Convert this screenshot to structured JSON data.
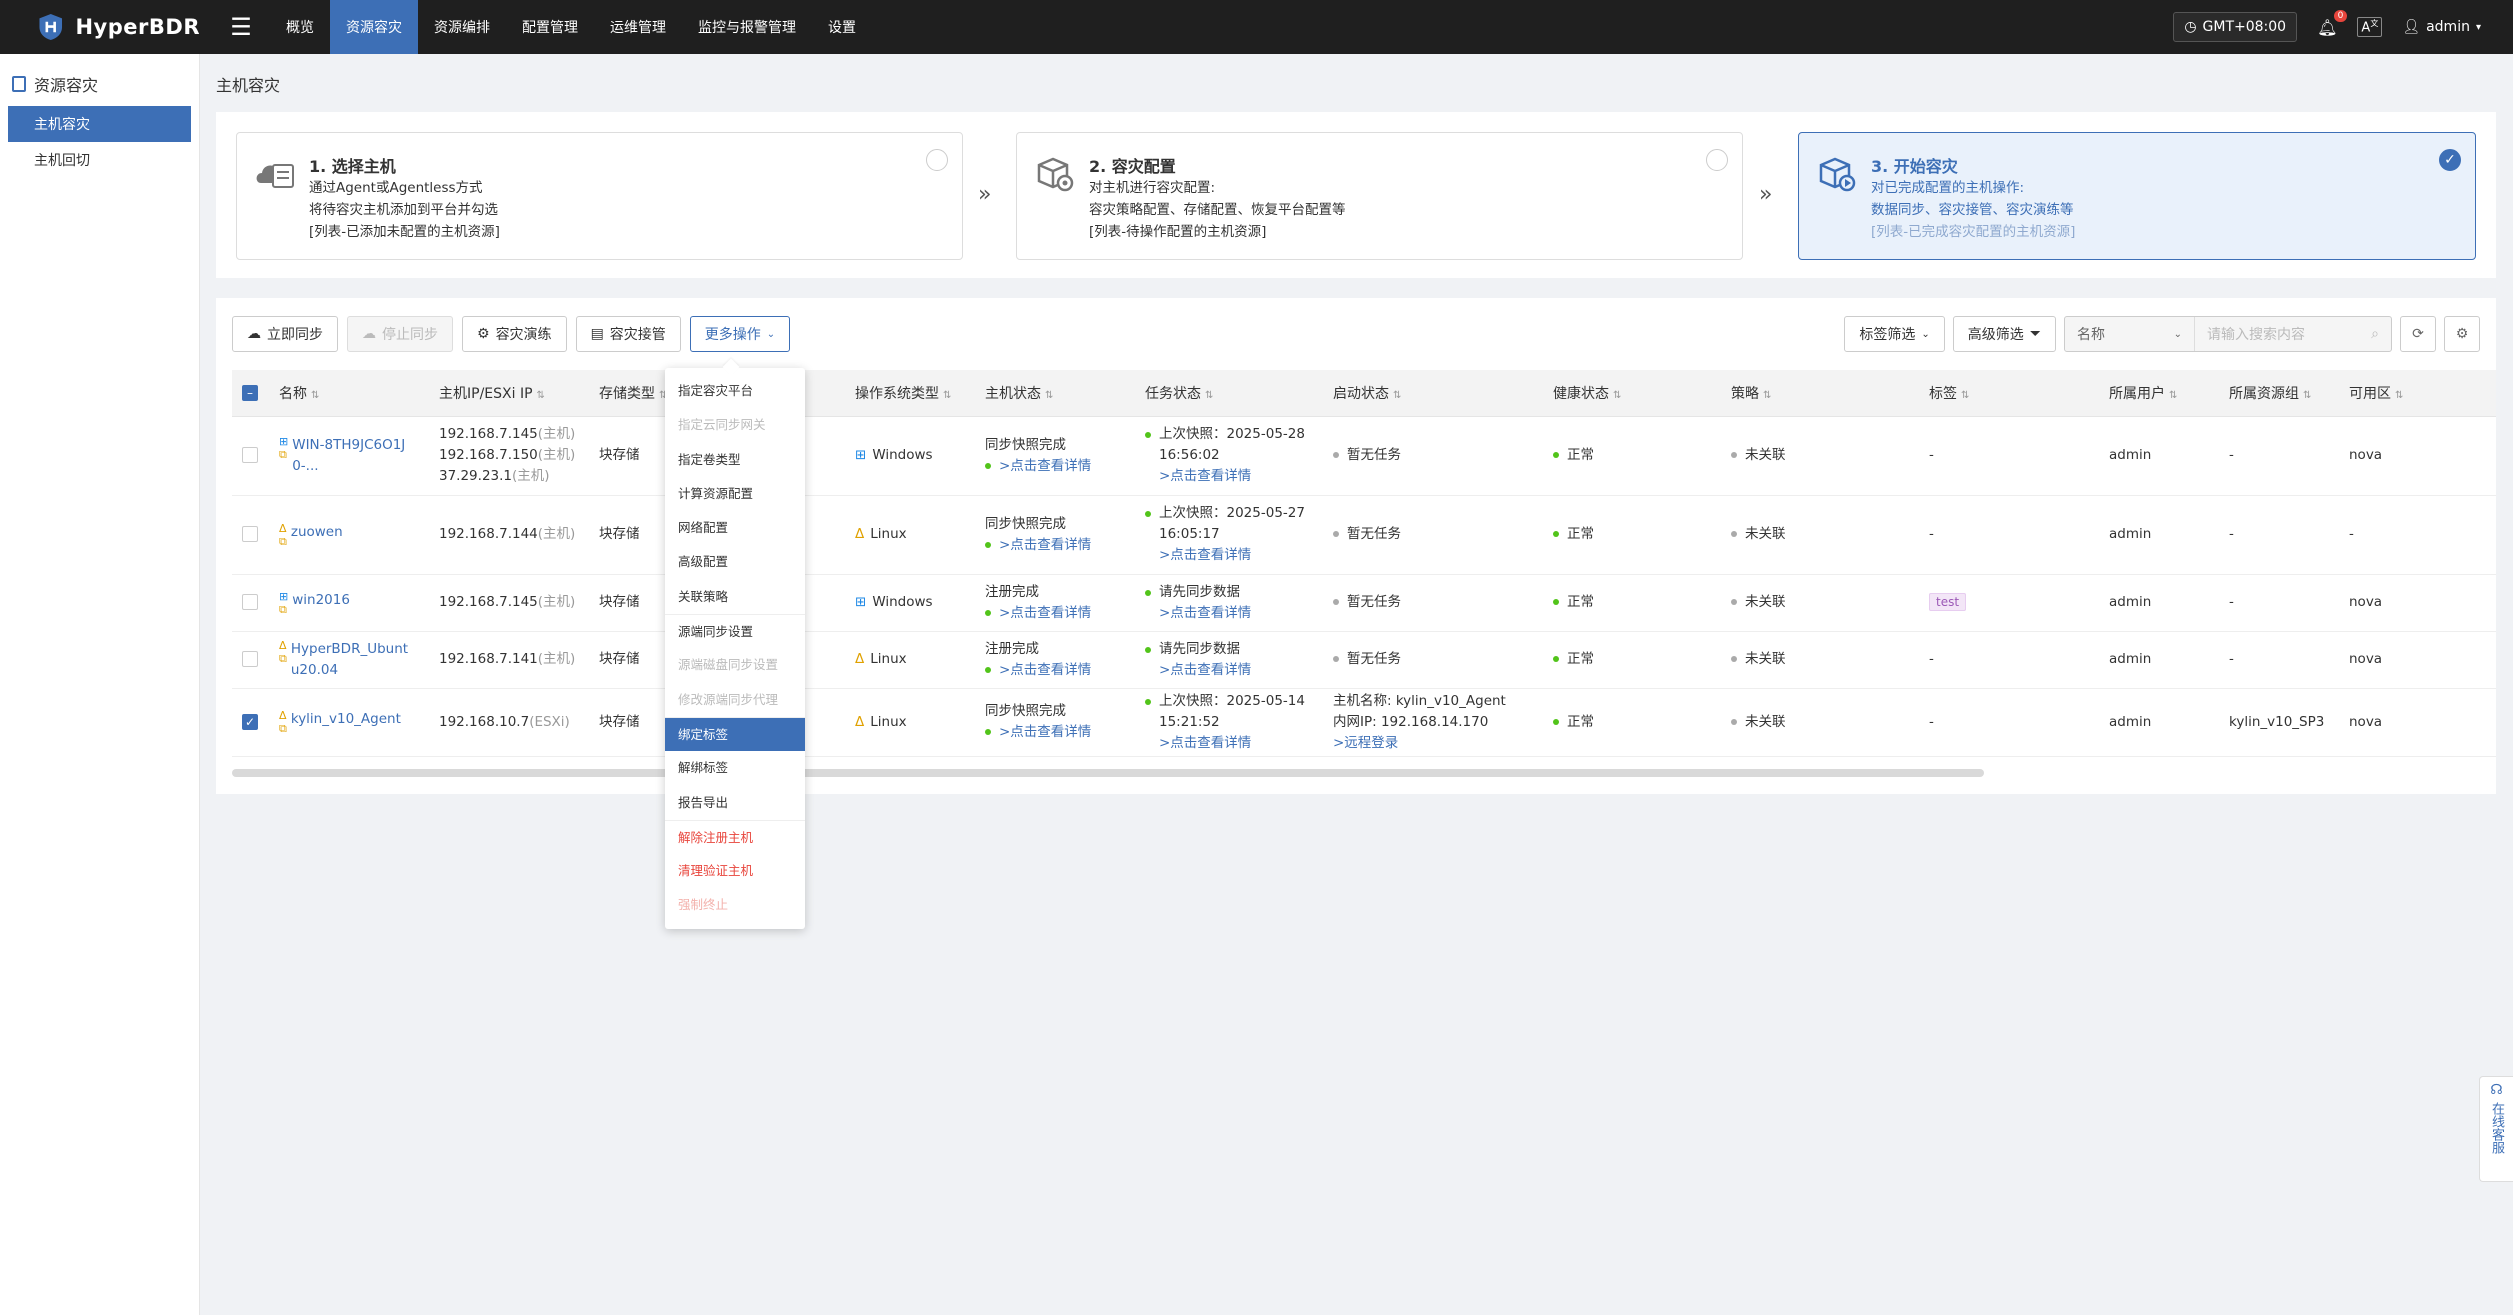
{
  "header": {
    "brand": "HyperBDR",
    "nav": [
      "概览",
      "资源容灾",
      "资源编排",
      "配置管理",
      "运维管理",
      "监控与报警管理",
      "设置"
    ],
    "active_nav": 1,
    "timezone": "GMT+08:00",
    "notification_count": "0",
    "user": "admin"
  },
  "sidebar": {
    "title": "资源容灾",
    "items": [
      "主机容灾",
      "主机回切"
    ]
  },
  "page_title": "主机容灾",
  "steps": [
    {
      "title": "1. 选择主机",
      "lines": [
        "通过Agent或Agentless方式",
        "将待容灾主机添加到平台并勾选",
        "[列表-已添加未配置的主机资源]"
      ]
    },
    {
      "title": "2. 容灾配置",
      "lines": [
        "对主机进行容灾配置:",
        "容灾策略配置、存储配置、恢复平台配置等",
        "[列表-待操作配置的主机资源]"
      ]
    },
    {
      "title": "3. 开始容灾",
      "lines": [
        "对已完成配置的主机操作:",
        "数据同步、容灾接管、容灾演练等",
        "[列表-已完成容灾配置的主机资源]"
      ]
    }
  ],
  "toolbar": {
    "sync_now": "立即同步",
    "stop_sync": "停止同步",
    "dr_drill": "容灾演练",
    "dr_takeover": "容灾接管",
    "more_ops": "更多操作",
    "tag_filter": "标签筛选",
    "adv_filter": "高级筛选",
    "search_field": "名称",
    "search_placeholder": "请输入搜索内容"
  },
  "columns": [
    "名称",
    "主机IP/ESXi IP",
    "存储类型",
    "操作系统类型",
    "主机状态",
    "任务状态",
    "启动状态",
    "健康状态",
    "策略",
    "标签",
    "所属用户",
    "所属资源组",
    "可用区"
  ],
  "rows": [
    {
      "name": "WIN-8TH9JC6O1J0-...",
      "os_icon": "windows",
      "ips": [
        "192.168.7.145",
        "192.168.7.150",
        "37.29.23.1"
      ],
      "ip_suffix": "(主机)",
      "storage": "块存储",
      "os": "Windows",
      "host_status": "同步快照完成",
      "host_link": ">点击查看详情",
      "task_lines": [
        "上次快照：2025-05-28",
        "16:56:02"
      ],
      "task_link": ">点击查看详情",
      "boot": "暂无任务",
      "health": "正常",
      "policy": "未关联",
      "tag": "-",
      "user": "admin",
      "group": "-",
      "zone": "nova",
      "checked": false
    },
    {
      "name": "zuowen",
      "os_icon": "linux",
      "ips": [
        "192.168.7.144"
      ],
      "ip_suffix": "(主机)",
      "storage": "块存储",
      "os": "Linux",
      "host_status": "同步快照完成",
      "host_link": ">点击查看详情",
      "task_lines": [
        "上次快照：2025-05-27",
        "16:05:17"
      ],
      "task_link": ">点击查看详情",
      "boot": "暂无任务",
      "health": "正常",
      "policy": "未关联",
      "tag": "-",
      "user": "admin",
      "group": "-",
      "zone": "-",
      "checked": false
    },
    {
      "name": "win2016",
      "os_icon": "windows",
      "ips": [
        "192.168.7.145"
      ],
      "ip_suffix": "(主机)",
      "storage": "块存储",
      "os": "Windows",
      "host_status": "注册完成",
      "host_link": ">点击查看详情",
      "task_lines": [
        "请先同步数据"
      ],
      "task_link": ">点击查看详情",
      "boot": "暂无任务",
      "health": "正常",
      "policy": "未关联",
      "tag": "test",
      "user": "admin",
      "group": "-",
      "zone": "nova",
      "checked": false
    },
    {
      "name": "HyperBDR_Ubuntu20.04",
      "os_icon": "linux",
      "ips": [
        "192.168.7.141"
      ],
      "ip_suffix": "(主机)",
      "storage": "块存储",
      "os": "Linux",
      "host_status": "注册完成",
      "host_link": ">点击查看详情",
      "task_lines": [
        "请先同步数据"
      ],
      "task_link": ">点击查看详情",
      "boot": "暂无任务",
      "health": "正常",
      "policy": "未关联",
      "tag": "-",
      "user": "admin",
      "group": "-",
      "zone": "nova",
      "checked": false
    },
    {
      "name": "kylin_v10_Agent",
      "os_icon": "linux",
      "ips": [
        "192.168.10.7"
      ],
      "ip_suffix": "(ESXi)",
      "storage": "块存储",
      "os": "Linux",
      "host_status": "同步快照完成",
      "host_link": ">点击查看详情",
      "task_lines": [
        "上次快照：2025-05-14",
        "15:21:52"
      ],
      "task_link": ">点击查看详情",
      "boot_lines": [
        "主机名称: kylin_v10_Agent",
        "内网IP: 192.168.14.170"
      ],
      "boot_link": ">远程登录",
      "health": "正常",
      "policy": "未关联",
      "tag": "-",
      "user": "admin",
      "group": "kylin_v10_SP3",
      "zone": "nova",
      "checked": true
    }
  ],
  "dropdown": [
    {
      "label": "指定容灾平台",
      "state": "normal"
    },
    {
      "label": "指定云同步网关",
      "state": "disabled"
    },
    {
      "label": "指定卷类型",
      "state": "normal"
    },
    {
      "label": "计算资源配置",
      "state": "normal"
    },
    {
      "label": "网络配置",
      "state": "normal"
    },
    {
      "label": "高级配置",
      "state": "normal"
    },
    {
      "label": "关联策略",
      "state": "normal"
    },
    {
      "label": "源端同步设置",
      "state": "normal"
    },
    {
      "label": "源端磁盘同步设置",
      "state": "disabled"
    },
    {
      "label": "修改源端同步代理",
      "state": "disabled"
    },
    {
      "label": "绑定标签",
      "state": "active"
    },
    {
      "label": "解绑标签",
      "state": "normal"
    },
    {
      "label": "报告导出",
      "state": "normal"
    },
    {
      "label": "解除注册主机",
      "state": "danger"
    },
    {
      "label": "清理验证主机",
      "state": "danger"
    },
    {
      "label": "强制终止",
      "state": "danger-disabled"
    }
  ],
  "service": "在线客服",
  "colors": {
    "accent": "#3d6fb6",
    "topbar": "#1f1f1f",
    "ok": "#52c41a",
    "danger": "#e8453c"
  }
}
